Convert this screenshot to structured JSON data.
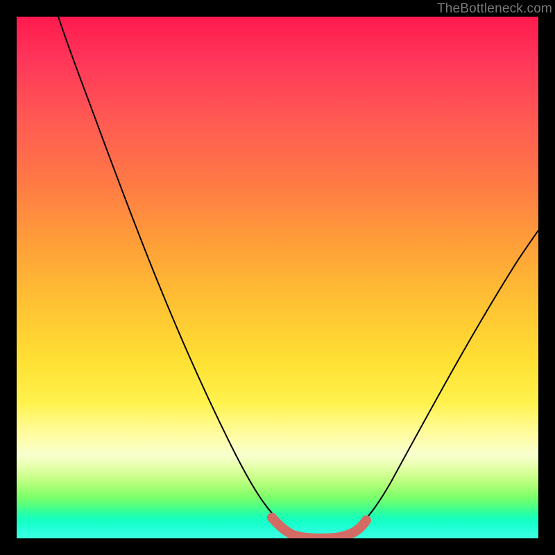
{
  "watermark": "TheBottleneck.com",
  "colors": {
    "background": "#000000",
    "curve": "#000000",
    "highlight": "#d46a64",
    "watermark": "#7b7b7b",
    "gradient_top": "#ff1a4d",
    "gradient_bottom": "#3bffdc"
  },
  "chart_data": {
    "type": "line",
    "title": "",
    "xlabel": "",
    "ylabel": "",
    "xlim": [
      0,
      100
    ],
    "ylim": [
      0,
      100
    ],
    "grid": false,
    "legend": false,
    "series": [
      {
        "name": "bottleneck-curve",
        "x": [
          8,
          12,
          16,
          20,
          24,
          28,
          32,
          36,
          40,
          44,
          48,
          50,
          52,
          54,
          56,
          58,
          60,
          62,
          64,
          66,
          70,
          74,
          78,
          82,
          86,
          90,
          94,
          98
        ],
        "values": [
          100,
          94,
          86,
          78,
          70,
          62,
          54,
          46,
          38,
          30,
          20,
          14,
          8,
          3,
          1,
          0,
          0,
          0,
          1,
          3,
          8,
          15,
          22,
          30,
          38,
          46,
          53,
          59
        ]
      },
      {
        "name": "optimal-valley-highlight",
        "x": [
          50,
          52,
          54,
          56,
          58,
          60,
          62,
          64,
          66
        ],
        "values": [
          14,
          8,
          3,
          1,
          0,
          0,
          0,
          1,
          3
        ]
      }
    ],
    "annotations": []
  }
}
